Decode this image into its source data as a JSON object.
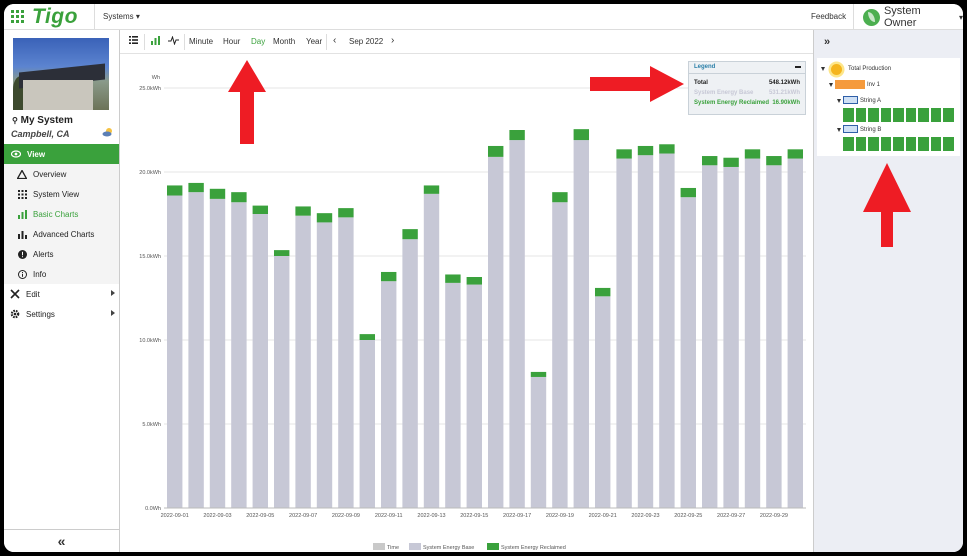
{
  "brand": {
    "name": "Tigo",
    "primary": "#3aa13c"
  },
  "topbar": {
    "systems_label": "Systems",
    "feedback_label": "Feedback",
    "owner_label": "System Owner"
  },
  "system": {
    "name": "My System",
    "location": "Campbell, CA"
  },
  "nav": {
    "view": "View",
    "overview": "Overview",
    "system_view": "System View",
    "basic_charts": "Basic Charts",
    "advanced_charts": "Advanced Charts",
    "alerts": "Alerts",
    "info": "Info",
    "edit": "Edit",
    "settings": "Settings",
    "collapse": "«"
  },
  "toolbar": {
    "minute": "Minute",
    "hour": "Hour",
    "day": "Day",
    "month": "Month",
    "year": "Year",
    "period": "Sep 2022",
    "prev": "‹",
    "next": "›"
  },
  "legend_popup": {
    "title": "Legend",
    "rows": [
      {
        "label": "Total",
        "value": "548.12kWh",
        "color": "#222222"
      },
      {
        "label": "System Energy Base",
        "value": "531.21kWh",
        "color": "#c7c8d6"
      },
      {
        "label": "System Energy Reclaimed",
        "value": "16.90kWh",
        "color": "#3aa13c"
      }
    ]
  },
  "right_panel": {
    "expand": "»",
    "total": "Total Production",
    "inverter": "Inv 1",
    "string_a": "String A",
    "string_b": "String B",
    "panel_color": "#3aa13c"
  },
  "chart_data": {
    "type": "bar",
    "stacked": true,
    "ylabel": "Wh",
    "ylim": [
      0,
      25000
    ],
    "yticks": [
      "0.0Wh",
      "5.0kWh",
      "10.0kWh",
      "15.0kWh",
      "20.0kWh",
      "25.0kWh"
    ],
    "categories": [
      "2022-09-01",
      "2022-09-02",
      "2022-09-03",
      "2022-09-04",
      "2022-09-05",
      "2022-09-06",
      "2022-09-07",
      "2022-09-08",
      "2022-09-09",
      "2022-09-10",
      "2022-09-11",
      "2022-09-12",
      "2022-09-13",
      "2022-09-14",
      "2022-09-15",
      "2022-09-16",
      "2022-09-17",
      "2022-09-18",
      "2022-09-19",
      "2022-09-20",
      "2022-09-21",
      "2022-09-22",
      "2022-09-23",
      "2022-09-24",
      "2022-09-25",
      "2022-09-26",
      "2022-09-27",
      "2022-09-28",
      "2022-09-29",
      "2022-09-30"
    ],
    "xtick_labels": [
      "2022-09-01",
      "",
      "2022-09-03",
      "",
      "2022-09-05",
      "",
      "2022-09-07",
      "",
      "2022-09-09",
      "",
      "2022-09-11",
      "",
      "2022-09-13",
      "",
      "2022-09-15",
      "",
      "2022-09-17",
      "",
      "2022-09-19",
      "",
      "2022-09-21",
      "",
      "2022-09-23",
      "",
      "2022-09-25",
      "",
      "2022-09-27",
      "",
      "2022-09-29",
      ""
    ],
    "series": [
      {
        "name": "Time",
        "color": "#c9c9c9",
        "values": []
      },
      {
        "name": "System Energy Base",
        "color": "#c7c8d6",
        "values": [
          18600,
          18800,
          18400,
          18200,
          17500,
          15000,
          17400,
          17000,
          17300,
          10000,
          13500,
          16000,
          18700,
          13400,
          13300,
          20900,
          21900,
          7800,
          18200,
          21900,
          12600,
          20800,
          21000,
          21100,
          18500,
          20400,
          20300,
          20800,
          20400,
          20800
        ]
      },
      {
        "name": "System Energy Reclaimed",
        "color": "#3aa13c",
        "values": [
          600,
          550,
          600,
          600,
          500,
          350,
          550,
          550,
          550,
          350,
          550,
          600,
          500,
          500,
          450,
          650,
          600,
          300,
          600,
          650,
          500,
          550,
          550,
          550,
          550,
          550,
          550,
          550,
          550,
          550
        ]
      }
    ],
    "legend": "bottom"
  }
}
